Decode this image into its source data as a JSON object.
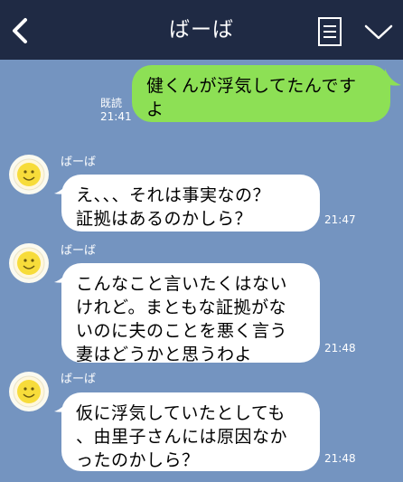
{
  "header": {
    "title": "ばーば",
    "back_icon": "chevron-left-icon",
    "menu_icon": "notes-icon",
    "more_icon": "chevron-down-icon"
  },
  "colors": {
    "background": "#7494c0",
    "header": "#1f2a44",
    "sent_bubble": "#8de055",
    "received_bubble": "#ffffff"
  },
  "messages": [
    {
      "direction": "sent",
      "text": "健くんが浮気してたんです\nよ",
      "read_label": "既読",
      "time": "21:41"
    },
    {
      "direction": "received",
      "sender": "ばーば",
      "text": "え、、、それは事実なの？\n証拠はあるのかしら？",
      "time": "21:47"
    },
    {
      "direction": "received",
      "sender": "ばーば",
      "text": "こんなこと言いたくはない\nけれど。まともな証拠がな\nいのに夫のことを悪く言う\n妻はどうかと思うわよ",
      "time": "21:48"
    },
    {
      "direction": "received",
      "sender": "ばーば",
      "text": "仮に浮気していたとしても\n、由里子さんには原因なか\nったのかしら？",
      "time": "21:48"
    }
  ]
}
